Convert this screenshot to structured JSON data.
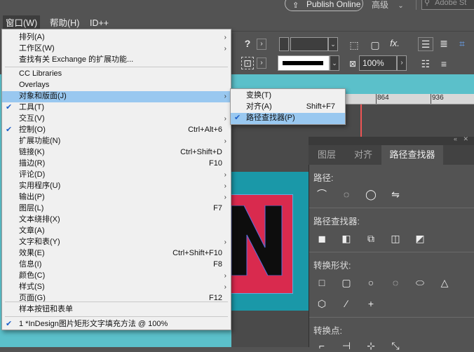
{
  "appbar": {
    "publish_label": "Publish Online",
    "workspace_label": "高级",
    "search_placeholder": "Adobe St"
  },
  "menubar": {
    "items": [
      {
        "label": "窗口(W)"
      },
      {
        "label": "帮助(H)"
      },
      {
        "label": "ID++"
      }
    ]
  },
  "control": {
    "zoom": "100%",
    "fx_label": "fx."
  },
  "ruler": {
    "labels": [
      "864",
      "936"
    ]
  },
  "window_menu": {
    "items": [
      {
        "label": "排列(A)",
        "submenu": true
      },
      {
        "label": "工作区(W)",
        "submenu": true
      },
      {
        "label": "查找有关 Exchange 的扩展功能..."
      },
      {
        "label": "CC Libraries"
      },
      {
        "label": "Overlays"
      },
      {
        "label": "对象和版面(J)",
        "submenu": true,
        "highlighted": true
      },
      {
        "label": "工具(T)",
        "checked": true
      },
      {
        "label": "交互(V)",
        "submenu": true
      },
      {
        "label": "控制(O)",
        "checked": true,
        "shortcut": "Ctrl+Alt+6"
      },
      {
        "label": "扩展功能(N)",
        "submenu": true
      },
      {
        "label": "链接(K)",
        "shortcut": "Ctrl+Shift+D"
      },
      {
        "label": "描边(R)",
        "shortcut": "F10"
      },
      {
        "label": "评论(D)",
        "submenu": true
      },
      {
        "label": "实用程序(U)",
        "submenu": true
      },
      {
        "label": "输出(P)",
        "submenu": true
      },
      {
        "label": "图层(L)",
        "shortcut": "F7"
      },
      {
        "label": "文本绕排(X)"
      },
      {
        "label": "文章(A)"
      },
      {
        "label": "文字和表(Y)",
        "submenu": true
      },
      {
        "label": "效果(E)",
        "shortcut": "Ctrl+Shift+F10"
      },
      {
        "label": "信息(I)",
        "shortcut": "F8"
      },
      {
        "label": "颜色(C)",
        "submenu": true
      },
      {
        "label": "样式(S)",
        "submenu": true
      },
      {
        "label": "页面(G)",
        "shortcut": "F12"
      },
      {
        "label": "样本按钮和表单"
      },
      {
        "label": "1 *InDesign图片矩形文字填充方法 @ 100%",
        "checked": true
      }
    ]
  },
  "submenu": {
    "items": [
      {
        "label": "变换(T)"
      },
      {
        "label": "对齐(A)",
        "shortcut": "Shift+F7"
      },
      {
        "label": "路径查找器(P)",
        "checked": true,
        "highlighted": true
      }
    ]
  },
  "panel": {
    "tabs": [
      "图层",
      "对齐",
      "路径查找器"
    ],
    "sections": {
      "path": "路径:",
      "pathfinder": "路径查找器:",
      "convert_shape": "转换形状:",
      "convert_point": "转换点:"
    }
  }
}
